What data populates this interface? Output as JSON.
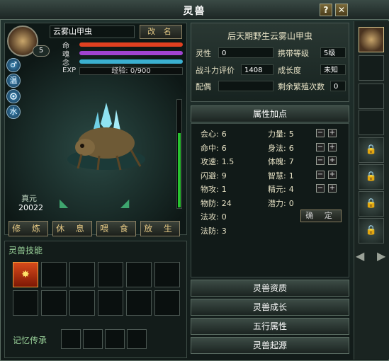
{
  "window": {
    "title": "灵兽",
    "help": "?",
    "close": "✕"
  },
  "pet": {
    "name": "云雾山甲虫",
    "rename_label": "改 名",
    "level": "5",
    "bars": [
      {
        "label": "命",
        "color": "#e04020",
        "fill": 1.0
      },
      {
        "label": "魂",
        "color": "#a043d0",
        "fill": 1.0
      },
      {
        "label": "念",
        "color": "#3bb0d0",
        "fill": 1.0
      }
    ],
    "exp_label": "EXP",
    "exp_text": "经验: 0/900",
    "elements": [
      "♂",
      "温",
      "",
      "水"
    ],
    "zhenyuan_label": "真元",
    "zhenyuan_value": "20022",
    "gauge_fill": 0.7
  },
  "actions": [
    "修 炼",
    "休 息",
    "喂 食",
    "放 生"
  ],
  "skills": {
    "title": "灵兽技能",
    "filled_glyph": "✸",
    "memory_title": "记忆传承"
  },
  "info": {
    "title": "后天期野生云雾山甲虫",
    "spirit_label": "灵性",
    "spirit_value": "0",
    "carry_label": "携带等级",
    "carry_value": "5级",
    "power_label": "战斗力评价",
    "power_value": "1408",
    "growth_label": "成长度",
    "growth_value": "未知",
    "mate_label": "配偶",
    "mate_value": "",
    "breed_label": "剩余繁殖次数",
    "breed_value": "0"
  },
  "attributes": {
    "header": "属性加点",
    "left": [
      {
        "label": "会心",
        "value": "6"
      },
      {
        "label": "命中",
        "value": "6"
      },
      {
        "label": "攻速",
        "value": "1.5"
      },
      {
        "label": "闪避",
        "value": "9"
      },
      {
        "label": "物攻",
        "value": "1"
      },
      {
        "label": "物防",
        "value": "24"
      },
      {
        "label": "法攻",
        "value": "0"
      },
      {
        "label": "法防",
        "value": "3"
      }
    ],
    "right": [
      {
        "label": "力量",
        "value": "5"
      },
      {
        "label": "身法",
        "value": "6"
      },
      {
        "label": "体魄",
        "value": "7"
      },
      {
        "label": "智慧",
        "value": "1"
      },
      {
        "label": "精元",
        "value": "4"
      },
      {
        "label": "潜力",
        "value": "0"
      }
    ],
    "confirm_label": "确 定"
  },
  "tabs": [
    "灵兽资质",
    "灵兽成长",
    "五行属性",
    "灵兽起源"
  ],
  "strip": {
    "left_arrow": "◀",
    "right_arrow": "▶"
  }
}
